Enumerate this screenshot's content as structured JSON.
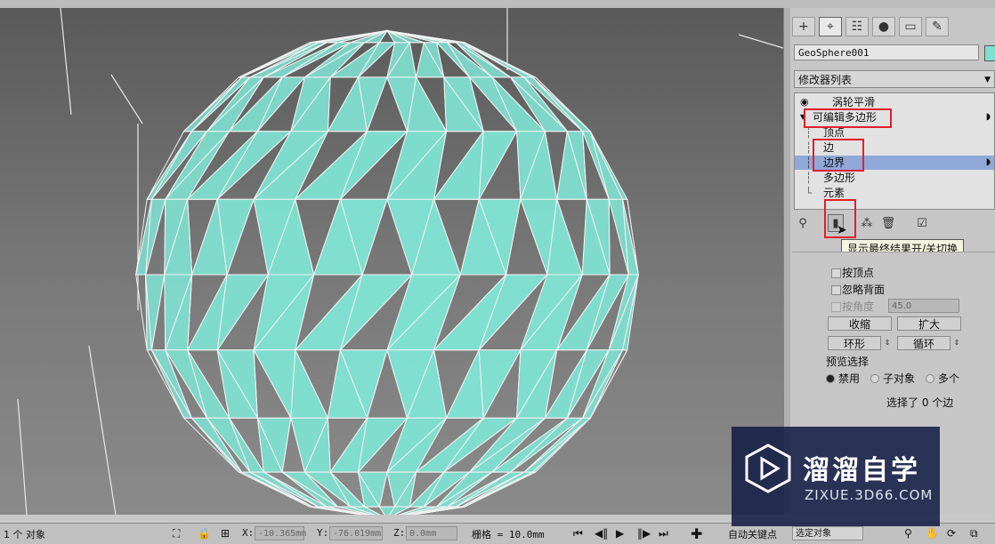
{
  "command_panel": {
    "object_name": "GeoSphere001",
    "object_color": "#7fe0d0",
    "modifier_list_label": "修改器列表",
    "stack": [
      {
        "label": "涡轮平滑",
        "level": 0
      },
      {
        "label": "可编辑多边形",
        "level": 0
      },
      {
        "label": "顶点",
        "level": 1
      },
      {
        "label": "边",
        "level": 1
      },
      {
        "label": "边界",
        "level": 1,
        "selected": true
      },
      {
        "label": "多边形",
        "level": 1
      },
      {
        "label": "元素",
        "level": 1
      }
    ],
    "tooltip": "显示最终结果开/关切换",
    "selection": {
      "by_vertex": "按顶点",
      "ignore_backfacing": "忽略背面",
      "by_angle": "按角度",
      "angle_value": "45.0",
      "shrink": "收缩",
      "grow": "扩大",
      "ring": "环形",
      "loop": "循环",
      "preview_selection": "预览选择",
      "disabled": "禁用",
      "sub_object": "子对象",
      "multi": "多个",
      "status": "选择了 0 个边"
    }
  },
  "status_bar": {
    "selected": "1 个 对象",
    "x_label": "X:",
    "x_value": "-10.365mm",
    "y_label": "Y:",
    "y_value": "-76.019mm",
    "z_label": "Z:",
    "z_value": "0.0mm",
    "grid": "栅格 = 10.0mm",
    "auto_key": "自动关键点",
    "selected_object": "选定对象"
  },
  "watermark": {
    "title": "溜溜自学",
    "subtitle": "ZIXUE.3D66.COM"
  },
  "colors": {
    "accent": "#8fa8d8",
    "highlight_box": "#e0202a",
    "mesh_face": "#7fe0d0"
  }
}
